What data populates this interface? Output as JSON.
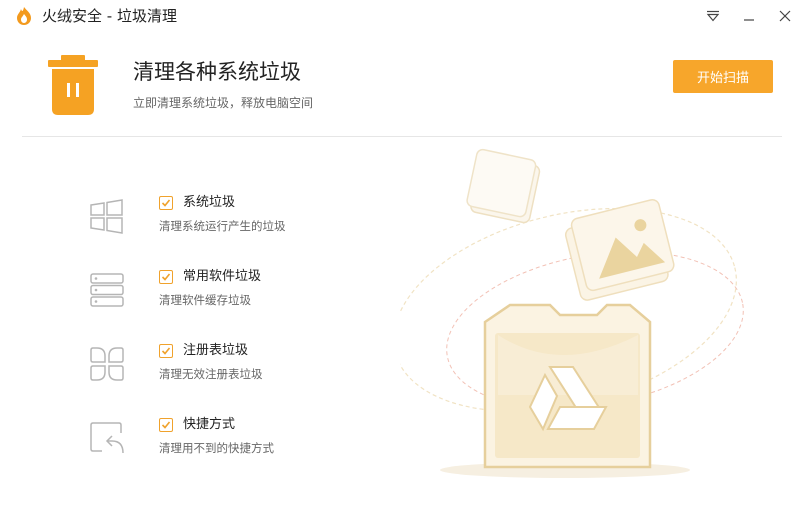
{
  "window": {
    "title": "火绒安全 - 垃圾清理",
    "controls": [
      "menu-triangle-icon",
      "minimize-icon",
      "close-icon"
    ]
  },
  "header": {
    "icon": "trash-bin-icon",
    "title": "清理各种系统垃圾",
    "subtitle": "立即清理系统垃圾，释放电脑空间",
    "scan_button": "开始扫描"
  },
  "items": [
    {
      "icon": "windows-icon",
      "checked": true,
      "title": "系统垃圾",
      "desc": "清理系统运行产生的垃圾"
    },
    {
      "icon": "server-stack-icon",
      "checked": true,
      "title": "常用软件垃圾",
      "desc": "清理软件缓存垃圾"
    },
    {
      "icon": "registry-grid-icon",
      "checked": true,
      "title": "注册表垃圾",
      "desc": "清理无效注册表垃圾"
    },
    {
      "icon": "shortcut-arrow-icon",
      "checked": true,
      "title": "快捷方式",
      "desc": "清理用不到的快捷方式"
    }
  ],
  "colors": {
    "accent": "#f7a62b",
    "icon_gray": "#b5b5b5",
    "illustration_tan": "#e8d6ad"
  }
}
